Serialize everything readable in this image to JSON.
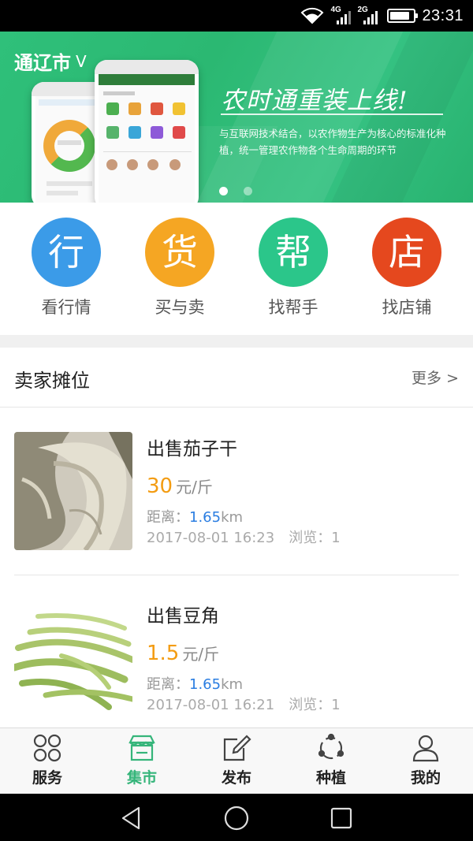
{
  "status_bar": {
    "time": "23:31",
    "net1": "4G",
    "net2": "2G"
  },
  "banner": {
    "city": "通辽市",
    "city_chevron": "V",
    "headline": "农时通重装上线!",
    "slogan": "与互联网技术结合，以农作物生产为核心的标准化种植，统一管理农作物各个生命周期的环节",
    "page_index": 1,
    "page_count": 2
  },
  "categories": [
    {
      "glyph": "行",
      "label": "看行情",
      "color": "#3b9be8"
    },
    {
      "glyph": "货",
      "label": "买与卖",
      "color": "#f5a623"
    },
    {
      "glyph": "帮",
      "label": "找帮手",
      "color": "#2bc68a"
    },
    {
      "glyph": "店",
      "label": "找店铺",
      "color": "#e5481e"
    }
  ],
  "section": {
    "title": "卖家摊位",
    "more": "更多 >"
  },
  "listings": [
    {
      "title": "出售茄子干",
      "price": "30",
      "unit": "元/斤",
      "distance_label": "距离：",
      "distance": "1.65",
      "distance_unit": "km",
      "datetime": "2017-08-01 16:23",
      "views_label": "浏览：",
      "views": "1",
      "image": "dried-eggplant-photo"
    },
    {
      "title": "出售豆角",
      "price": "1.5",
      "unit": "元/斤",
      "distance_label": "距离：",
      "distance": "1.65",
      "distance_unit": "km",
      "datetime": "2017-08-01 16:21",
      "views_label": "浏览：",
      "views": "1",
      "image": "green-beans-photo"
    }
  ],
  "bottom_nav": [
    {
      "label": "服务",
      "icon": "grid-icon",
      "active": false
    },
    {
      "label": "集市",
      "icon": "market-stall-icon",
      "active": true
    },
    {
      "label": "发布",
      "icon": "edit-icon",
      "active": false
    },
    {
      "label": "种植",
      "icon": "cycle-icon",
      "active": false
    },
    {
      "label": "我的",
      "icon": "person-icon",
      "active": false
    }
  ],
  "colors": {
    "brand_green": "#35b57a",
    "price_orange": "#f39c12",
    "link_blue": "#2a7de1"
  }
}
